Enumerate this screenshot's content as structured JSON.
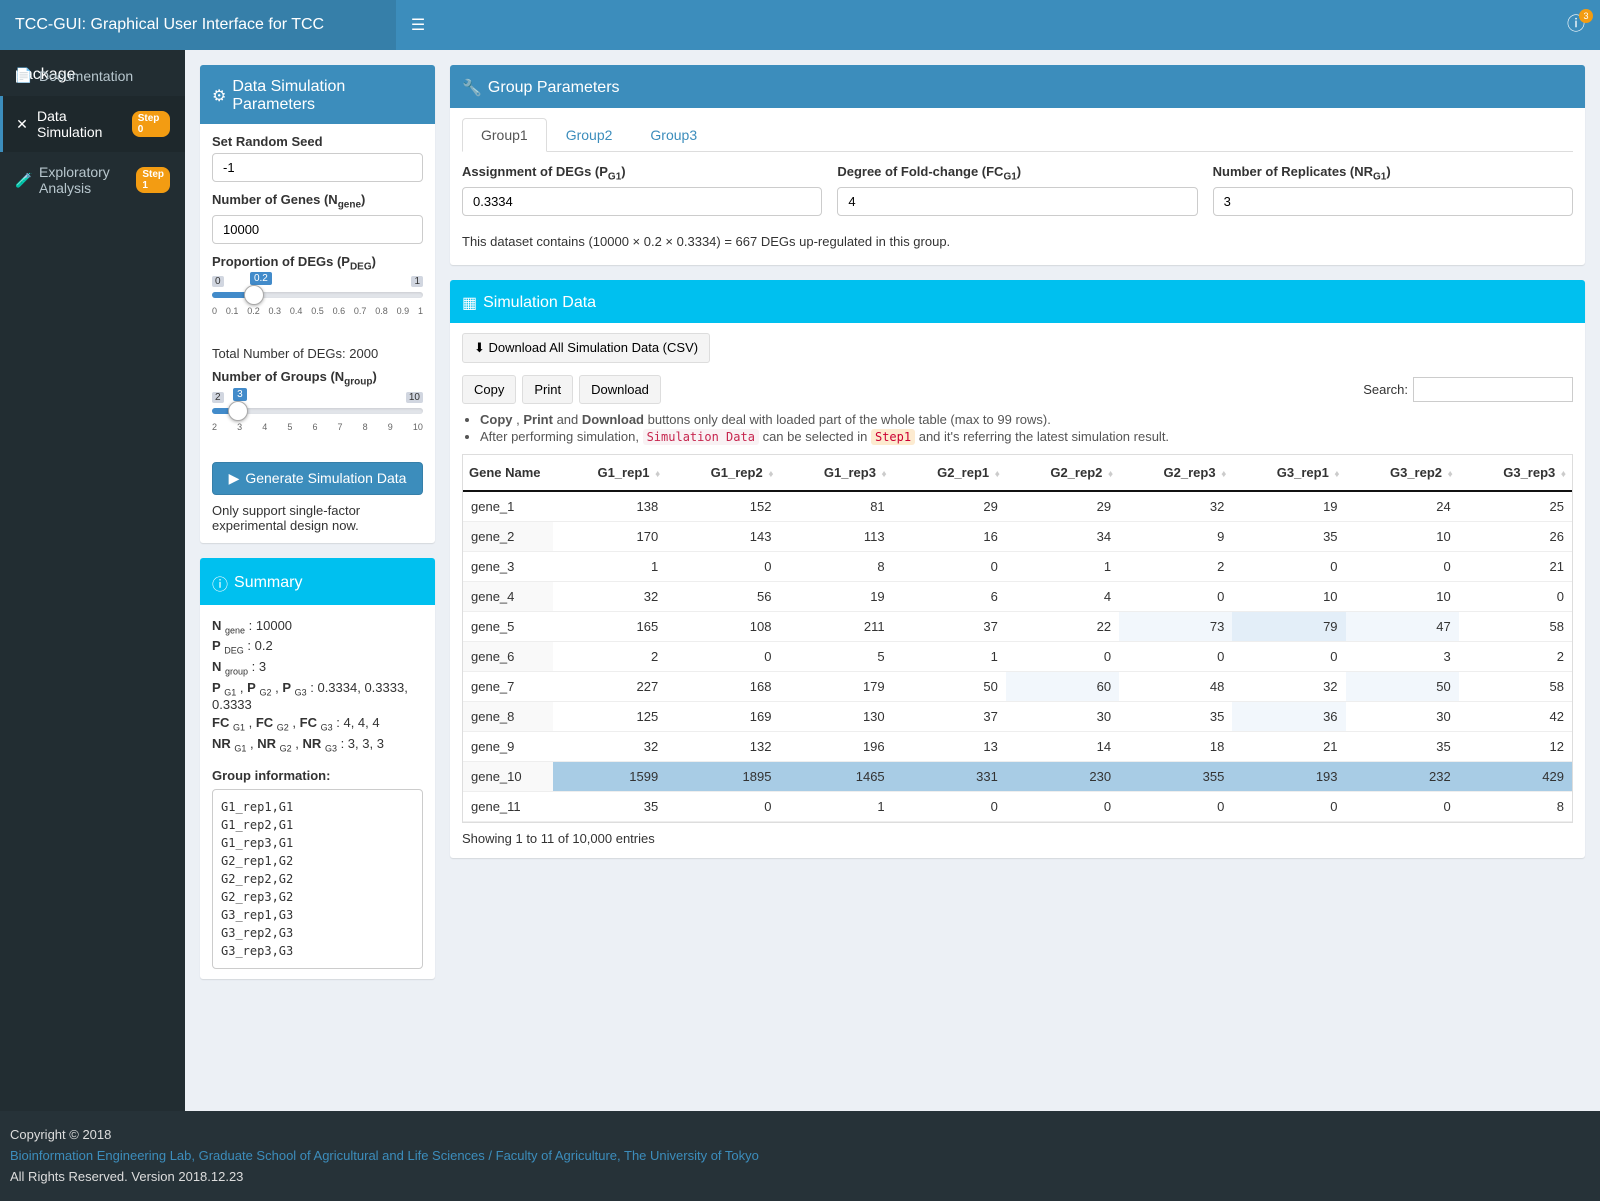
{
  "header": {
    "title": "TCC-GUI: Graphical User Interface for TCC package",
    "notif_badge": "3"
  },
  "sidebar": {
    "items": [
      {
        "icon": "📄",
        "label": "Documentation",
        "badge": null
      },
      {
        "icon": "✕",
        "label": "Data Simulation",
        "badge": "Step 0",
        "active": true
      },
      {
        "icon": "🧪",
        "label": "Exploratory Analysis",
        "badge": "Step 1"
      }
    ]
  },
  "sim_params": {
    "title": "Data Simulation Parameters",
    "seed_label": "Set Random Seed",
    "seed_value": "-1",
    "ngene_label_html": "Number of Genes (N<sub>gene</sub>)",
    "ngene_value": "10000",
    "pdeg_label_html": "Proportion of DEGs (P<sub>DEG</sub>)",
    "pdeg_value": "0.2",
    "pdeg_min": "0",
    "pdeg_max": "1",
    "pdeg_ticks": [
      "0",
      "0.1",
      "0.2",
      "0.3",
      "0.4",
      "0.5",
      "0.6",
      "0.7",
      "0.8",
      "0.9",
      "1"
    ],
    "total_degs": "Total Number of DEGs: 2000",
    "ngroup_label_html": "Number of Groups (N<sub>group</sub>)",
    "ngroup_value": "3",
    "ngroup_min": "2",
    "ngroup_max": "10",
    "ngroup_ticks": [
      "2",
      "3",
      "4",
      "5",
      "6",
      "7",
      "8",
      "9",
      "10"
    ],
    "generate_btn": "Generate Simulation Data",
    "help_text": "Only support single-factor experimental design now."
  },
  "summary": {
    "title": "Summary",
    "lines": [
      "<b>N</b> <sub>gene</sub> : 10000",
      "<b>P</b> <sub>DEG</sub> : 0.2",
      "<b>N</b> <sub>group</sub> : 3",
      "<b>P</b> <sub>G1</sub> , <b>P</b> <sub>G2</sub> , <b>P</b> <sub>G3</sub> : 0.3334, 0.3333, 0.3333",
      "<b>FC</b> <sub>G1</sub> , <b>FC</b> <sub>G2</sub> , <b>FC</b> <sub>G3</sub> : 4, 4, 4",
      "<b>NR</b> <sub>G1</sub> , <b>NR</b> <sub>G2</sub> , <b>NR</b> <sub>G3</sub> : 3, 3, 3"
    ],
    "group_info_label": "Group information:",
    "group_info": "G1_rep1,G1\nG1_rep2,G1\nG1_rep3,G1\nG2_rep1,G2\nG2_rep2,G2\nG2_rep3,G2\nG3_rep1,G3\nG3_rep2,G3\nG3_rep3,G3"
  },
  "group_params": {
    "title": "Group Parameters",
    "tabs": [
      "Group1",
      "Group2",
      "Group3"
    ],
    "active_tab": 0,
    "deg_label_html": "Assignment of DEGs (P<sub>G1</sub>)",
    "deg_value": "0.3334",
    "fc_label_html": "Degree of Fold-change (FC<sub>G1</sub>)",
    "fc_value": "4",
    "nr_label_html": "Number of Replicates (NR<sub>G1</sub>)",
    "nr_value": "3",
    "note": "This dataset contains (10000 × 0.2 × 0.3334) = 667 DEGs up-regulated in this group."
  },
  "sim_data": {
    "title": "Simulation Data",
    "download_all": "Download All Simulation Data (CSV)",
    "buttons": [
      "Copy",
      "Print",
      "Download"
    ],
    "search_label": "Search:",
    "note1_html": "<b>Copy</b> , <b>Print</b> and <b>Download</b> buttons only deal with loaded part of the whole table (max to 99 rows).",
    "note2_html": "After performing simulation, <span class='code-inline'>Simulation Data</span> can be selected in <span class='code-step'>Step1</span> and it's referring the latest simulation result.",
    "columns": [
      "Gene Name",
      "G1_rep1",
      "G1_rep2",
      "G1_rep3",
      "G2_rep1",
      "G2_rep2",
      "G2_rep3",
      "G3_rep1",
      "G3_rep2",
      "G3_rep3"
    ],
    "rows": [
      [
        "gene_1",
        138,
        152,
        81,
        29,
        29,
        32,
        19,
        24,
        25
      ],
      [
        "gene_2",
        170,
        143,
        113,
        16,
        34,
        9,
        35,
        10,
        26
      ],
      [
        "gene_3",
        1,
        0,
        8,
        0,
        1,
        2,
        0,
        0,
        21
      ],
      [
        "gene_4",
        32,
        56,
        19,
        6,
        4,
        0,
        10,
        10,
        0
      ],
      [
        "gene_5",
        165,
        108,
        211,
        37,
        22,
        73,
        79,
        47,
        58
      ],
      [
        "gene_6",
        2,
        0,
        5,
        1,
        0,
        0,
        0,
        3,
        2
      ],
      [
        "gene_7",
        227,
        168,
        179,
        50,
        60,
        48,
        32,
        50,
        58
      ],
      [
        "gene_8",
        125,
        169,
        130,
        37,
        30,
        35,
        36,
        30,
        42
      ],
      [
        "gene_9",
        32,
        132,
        196,
        13,
        14,
        18,
        21,
        35,
        12
      ],
      [
        "gene_10",
        1599,
        1895,
        1465,
        331,
        230,
        355,
        193,
        232,
        429
      ],
      [
        "gene_11",
        35,
        0,
        1,
        0,
        0,
        0,
        0,
        0,
        8
      ]
    ],
    "footer_info": "Showing 1 to 11 of 10,000 entries"
  },
  "footer": {
    "copyright": "Copyright © 2018",
    "link_text": "Bioinformation Engineering Lab, Graduate School of Agricultural and Life Sciences / Faculty of Agriculture, The University of Tokyo",
    "rights": "All Rights Reserved. Version 2018.12.23"
  },
  "heat_colors": [
    "#a8cce5",
    "#bcd8ec",
    "#d0e3f2",
    "#e3eef8",
    "#f2f7fc",
    "#ffffff"
  ]
}
